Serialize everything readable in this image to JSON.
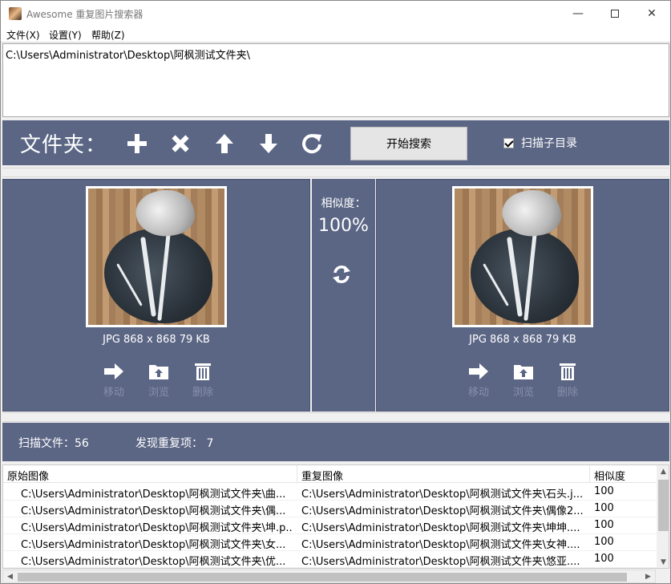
{
  "window": {
    "title": "Awesome 重复图片搜索器",
    "min_glyph": "—",
    "close_glyph": "✕"
  },
  "menu": [
    "文件(X)",
    "设置(Y)",
    "帮助(Z)"
  ],
  "path_list": [
    "C:\\Users\\Administrator\\Desktop\\阿枫测试文件夹\\"
  ],
  "toolbar": {
    "folder_label": "文件夹：",
    "icons": [
      "add-icon",
      "remove-icon",
      "move-up-icon",
      "move-down-icon",
      "refresh-icon"
    ],
    "search_button": "开始搜索",
    "subdir_label": "扫描子目录",
    "subdir_checked": true
  },
  "left_image": {
    "info": "JPG  868 x 868  79 KB",
    "actions": [
      "移动",
      "浏览",
      "删除"
    ]
  },
  "right_image": {
    "info": "JPG  868 x 868  79 KB",
    "actions": [
      "移动",
      "浏览",
      "删除"
    ]
  },
  "similarity": {
    "label": "相似度：",
    "value": "100%"
  },
  "status": {
    "scanned": "扫描文件：56",
    "found": "发现重复项： 7"
  },
  "table": {
    "headers": [
      "原始图像",
      "重复图像",
      "相似度"
    ],
    "rows": [
      [
        "C:\\Users\\Administrator\\Desktop\\阿枫测试文件夹\\曲...",
        "C:\\Users\\Administrator\\Desktop\\阿枫测试文件夹\\石头.j...",
        "100"
      ],
      [
        "C:\\Users\\Administrator\\Desktop\\阿枫测试文件夹\\偶...",
        "C:\\Users\\Administrator\\Desktop\\阿枫测试文件夹\\偶像2...",
        "100"
      ],
      [
        "C:\\Users\\Administrator\\Desktop\\阿枫测试文件夹\\坤.p...",
        "C:\\Users\\Administrator\\Desktop\\阿枫测试文件夹\\坤坤....",
        "100"
      ],
      [
        "C:\\Users\\Administrator\\Desktop\\阿枫测试文件夹\\女...",
        "C:\\Users\\Administrator\\Desktop\\阿枫测试文件夹\\女神....",
        "100"
      ],
      [
        "C:\\Users\\Administrator\\Desktop\\阿枫测试文件夹\\优...",
        "C:\\Users\\Administrator\\Desktop\\阿枫测试文件夹\\悠亚....",
        "100"
      ]
    ]
  },
  "colors": {
    "panel": "#5b6685",
    "disabled_text": "#8790aa"
  }
}
